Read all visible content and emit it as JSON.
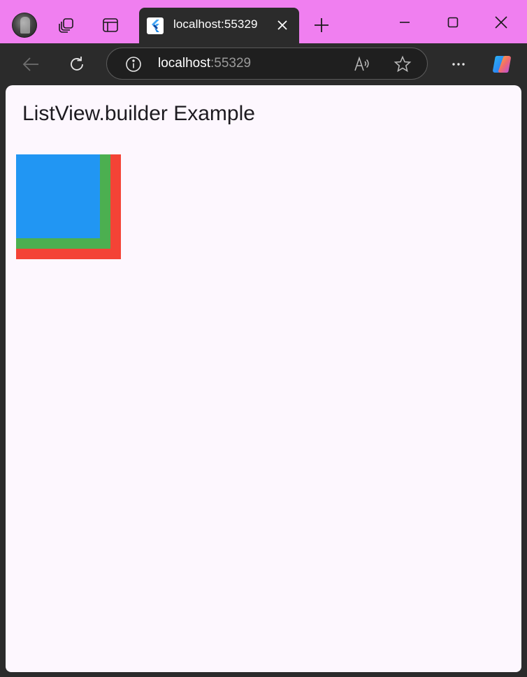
{
  "browser": {
    "tab": {
      "title": "localhost:55329",
      "favicon": "flutter-icon"
    },
    "address_bar": {
      "host": "localhost",
      "port": ":55329"
    },
    "icons": {
      "profile": "profile-avatar",
      "workspaces": "workspaces-icon",
      "vertical_tabs": "vertical-tabs-icon",
      "close_tab": "close-icon",
      "new_tab": "plus-icon",
      "minimize": "minimize-icon",
      "maximize": "maximize-icon",
      "close_window": "close-icon",
      "back": "back-arrow-icon",
      "refresh": "refresh-icon",
      "site_info": "info-icon",
      "read_aloud": "read-aloud-icon",
      "favorite": "star-icon",
      "more": "more-icon",
      "copilot": "copilot-icon"
    },
    "colors": {
      "frame": "#f07ff0",
      "toolbar": "#2b2b2b"
    }
  },
  "app": {
    "title": "ListView.builder Example",
    "background": "#fdf7fe",
    "boxes": [
      {
        "name": "red-box",
        "color": "#f44336"
      },
      {
        "name": "green-box",
        "color": "#4caf50"
      },
      {
        "name": "blue-box",
        "color": "#2196f3"
      }
    ]
  }
}
